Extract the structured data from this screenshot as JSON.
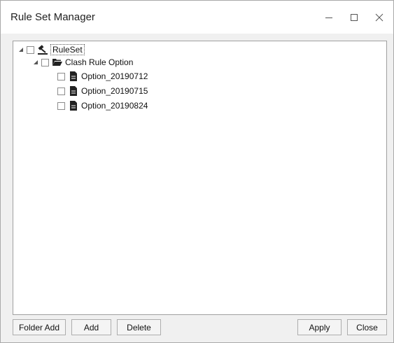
{
  "window": {
    "title": "Rule Set Manager"
  },
  "controls": {
    "minimize": "–",
    "maximize": "□",
    "close": "✕"
  },
  "tree": {
    "root": {
      "label": "RuleSet"
    },
    "folder": {
      "label": "Clash Rule Option"
    },
    "items": [
      {
        "label": "Option_20190712"
      },
      {
        "label": "Option_20190715"
      },
      {
        "label": "Option_20190824"
      }
    ]
  },
  "buttons": {
    "folder_add": "Folder Add",
    "add": "Add",
    "delete": "Delete",
    "apply": "Apply",
    "close": "Close"
  }
}
